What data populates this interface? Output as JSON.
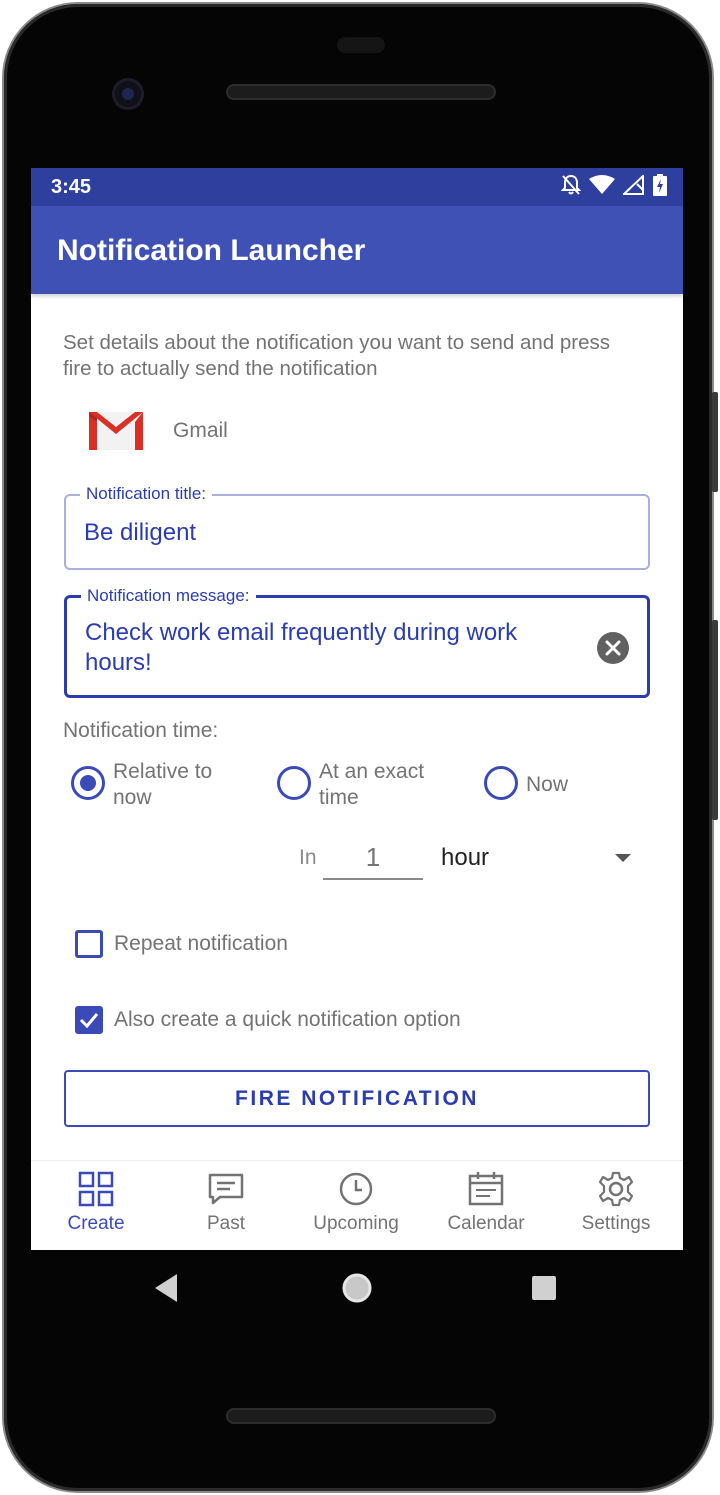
{
  "status_bar": {
    "time": "3:45",
    "icons": [
      "notifications-off-icon",
      "wifi-icon",
      "signal-icon",
      "battery-icon"
    ],
    "color": "#2f3f9e"
  },
  "app_bar": {
    "title": "Notification Launcher",
    "color": "#3f51b5"
  },
  "form": {
    "description": "Set details about the notification you want to send and press fire to actually send the notification",
    "app": {
      "name": "Gmail",
      "icon": "gmail-icon"
    },
    "title_field": {
      "label": "Notification title:",
      "value": "Be diligent"
    },
    "message_field": {
      "label": "Notification message:",
      "value": "Check work email frequently during work hours!",
      "clear_icon": "clear-icon"
    },
    "time": {
      "label": "Notification time:",
      "options": [
        {
          "label": "Relative to now",
          "selected": true
        },
        {
          "label": "At an exact time",
          "selected": false
        },
        {
          "label": "Now",
          "selected": false
        }
      ],
      "relative": {
        "prefix": "In",
        "amount_placeholder": "1",
        "unit": "hour"
      }
    },
    "repeat": {
      "label": "Repeat notification",
      "checked": false
    },
    "quick": {
      "label": "Also create a quick notification option",
      "checked": true
    },
    "fire_button": "FIRE NOTIFICATION"
  },
  "bottom_nav": {
    "items": [
      {
        "label": "Create",
        "icon": "grid-icon",
        "active": true
      },
      {
        "label": "Past",
        "icon": "message-icon",
        "active": false
      },
      {
        "label": "Upcoming",
        "icon": "clock-icon",
        "active": false
      },
      {
        "label": "Calendar",
        "icon": "calendar-icon",
        "active": false
      },
      {
        "label": "Settings",
        "icon": "gear-icon",
        "active": false
      }
    ]
  },
  "system_nav": [
    "back-icon",
    "home-icon",
    "recents-icon"
  ],
  "colors": {
    "accent": "#3a4bb8",
    "secondary_text": "#737373"
  }
}
